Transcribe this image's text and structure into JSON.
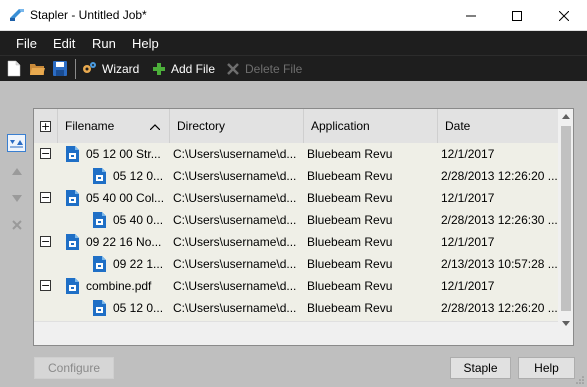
{
  "window": {
    "title": "Stapler - Untitled Job*"
  },
  "menu": [
    "File",
    "Edit",
    "Run",
    "Help"
  ],
  "toolbar": {
    "wizard_label": "Wizard",
    "add_file_label": "Add File",
    "delete_file_label": "Delete File"
  },
  "grid": {
    "columns": [
      "Filename",
      "Directory",
      "Application",
      "Date"
    ],
    "rows": [
      {
        "level": 0,
        "expander": "−",
        "filename": "05 12 00 Str...",
        "directory": "C:\\Users\\username\\d...",
        "application": "Bluebeam Revu",
        "date": "12/1/2017"
      },
      {
        "level": 1,
        "expander": "",
        "filename": "05 12 0...",
        "directory": "C:\\Users\\username\\d...",
        "application": "Bluebeam Revu",
        "date": "2/28/2013 12:26:20 ..."
      },
      {
        "level": 0,
        "expander": "−",
        "filename": "05 40 00 Col...",
        "directory": "C:\\Users\\username\\d...",
        "application": "Bluebeam Revu",
        "date": "12/1/2017"
      },
      {
        "level": 1,
        "expander": "",
        "filename": "05 40 0...",
        "directory": "C:\\Users\\username\\d...",
        "application": "Bluebeam Revu",
        "date": "2/28/2013 12:26:30 ..."
      },
      {
        "level": 0,
        "expander": "−",
        "filename": "09 22 16 No...",
        "directory": "C:\\Users\\username\\d...",
        "application": "Bluebeam Revu",
        "date": "12/1/2017"
      },
      {
        "level": 1,
        "expander": "",
        "filename": "09 22 1...",
        "directory": "C:\\Users\\username\\d...",
        "application": "Bluebeam Revu",
        "date": "2/13/2013 10:57:28 ..."
      },
      {
        "level": 0,
        "expander": "−",
        "filename": "combine.pdf",
        "directory": "C:\\Users\\username\\d...",
        "application": "Bluebeam Revu",
        "date": "12/1/2017"
      },
      {
        "level": 1,
        "expander": "",
        "filename": "05 12 0...",
        "directory": "C:\\Users\\username\\d...",
        "application": "Bluebeam Revu",
        "date": "2/28/2013 12:26:20 ..."
      }
    ]
  },
  "buttons": {
    "configure": "Configure",
    "staple": "Staple",
    "help": "Help"
  },
  "colors": {
    "menubar_bg": "#1e1e1e",
    "body_bg": "#bfbfbf",
    "row_bg": "#efefe7",
    "accent": "#3a7fd0"
  }
}
